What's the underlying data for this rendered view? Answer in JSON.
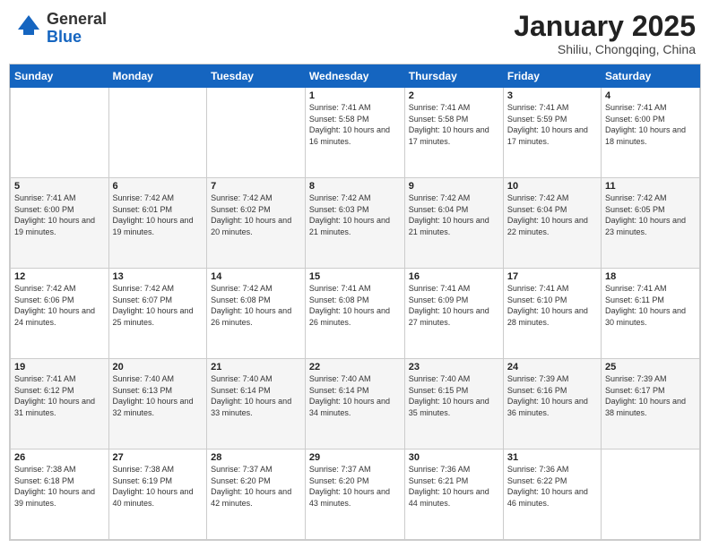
{
  "header": {
    "logo_general": "General",
    "logo_blue": "Blue",
    "month_title": "January 2025",
    "location": "Shiliu, Chongqing, China"
  },
  "days_of_week": [
    "Sunday",
    "Monday",
    "Tuesday",
    "Wednesday",
    "Thursday",
    "Friday",
    "Saturday"
  ],
  "weeks": [
    [
      {
        "day": "",
        "sunrise": "",
        "sunset": "",
        "daylight": ""
      },
      {
        "day": "",
        "sunrise": "",
        "sunset": "",
        "daylight": ""
      },
      {
        "day": "",
        "sunrise": "",
        "sunset": "",
        "daylight": ""
      },
      {
        "day": "1",
        "sunrise": "Sunrise: 7:41 AM",
        "sunset": "Sunset: 5:58 PM",
        "daylight": "Daylight: 10 hours and 16 minutes."
      },
      {
        "day": "2",
        "sunrise": "Sunrise: 7:41 AM",
        "sunset": "Sunset: 5:58 PM",
        "daylight": "Daylight: 10 hours and 17 minutes."
      },
      {
        "day": "3",
        "sunrise": "Sunrise: 7:41 AM",
        "sunset": "Sunset: 5:59 PM",
        "daylight": "Daylight: 10 hours and 17 minutes."
      },
      {
        "day": "4",
        "sunrise": "Sunrise: 7:41 AM",
        "sunset": "Sunset: 6:00 PM",
        "daylight": "Daylight: 10 hours and 18 minutes."
      }
    ],
    [
      {
        "day": "5",
        "sunrise": "Sunrise: 7:41 AM",
        "sunset": "Sunset: 6:00 PM",
        "daylight": "Daylight: 10 hours and 19 minutes."
      },
      {
        "day": "6",
        "sunrise": "Sunrise: 7:42 AM",
        "sunset": "Sunset: 6:01 PM",
        "daylight": "Daylight: 10 hours and 19 minutes."
      },
      {
        "day": "7",
        "sunrise": "Sunrise: 7:42 AM",
        "sunset": "Sunset: 6:02 PM",
        "daylight": "Daylight: 10 hours and 20 minutes."
      },
      {
        "day": "8",
        "sunrise": "Sunrise: 7:42 AM",
        "sunset": "Sunset: 6:03 PM",
        "daylight": "Daylight: 10 hours and 21 minutes."
      },
      {
        "day": "9",
        "sunrise": "Sunrise: 7:42 AM",
        "sunset": "Sunset: 6:04 PM",
        "daylight": "Daylight: 10 hours and 21 minutes."
      },
      {
        "day": "10",
        "sunrise": "Sunrise: 7:42 AM",
        "sunset": "Sunset: 6:04 PM",
        "daylight": "Daylight: 10 hours and 22 minutes."
      },
      {
        "day": "11",
        "sunrise": "Sunrise: 7:42 AM",
        "sunset": "Sunset: 6:05 PM",
        "daylight": "Daylight: 10 hours and 23 minutes."
      }
    ],
    [
      {
        "day": "12",
        "sunrise": "Sunrise: 7:42 AM",
        "sunset": "Sunset: 6:06 PM",
        "daylight": "Daylight: 10 hours and 24 minutes."
      },
      {
        "day": "13",
        "sunrise": "Sunrise: 7:42 AM",
        "sunset": "Sunset: 6:07 PM",
        "daylight": "Daylight: 10 hours and 25 minutes."
      },
      {
        "day": "14",
        "sunrise": "Sunrise: 7:42 AM",
        "sunset": "Sunset: 6:08 PM",
        "daylight": "Daylight: 10 hours and 26 minutes."
      },
      {
        "day": "15",
        "sunrise": "Sunrise: 7:41 AM",
        "sunset": "Sunset: 6:08 PM",
        "daylight": "Daylight: 10 hours and 26 minutes."
      },
      {
        "day": "16",
        "sunrise": "Sunrise: 7:41 AM",
        "sunset": "Sunset: 6:09 PM",
        "daylight": "Daylight: 10 hours and 27 minutes."
      },
      {
        "day": "17",
        "sunrise": "Sunrise: 7:41 AM",
        "sunset": "Sunset: 6:10 PM",
        "daylight": "Daylight: 10 hours and 28 minutes."
      },
      {
        "day": "18",
        "sunrise": "Sunrise: 7:41 AM",
        "sunset": "Sunset: 6:11 PM",
        "daylight": "Daylight: 10 hours and 30 minutes."
      }
    ],
    [
      {
        "day": "19",
        "sunrise": "Sunrise: 7:41 AM",
        "sunset": "Sunset: 6:12 PM",
        "daylight": "Daylight: 10 hours and 31 minutes."
      },
      {
        "day": "20",
        "sunrise": "Sunrise: 7:40 AM",
        "sunset": "Sunset: 6:13 PM",
        "daylight": "Daylight: 10 hours and 32 minutes."
      },
      {
        "day": "21",
        "sunrise": "Sunrise: 7:40 AM",
        "sunset": "Sunset: 6:14 PM",
        "daylight": "Daylight: 10 hours and 33 minutes."
      },
      {
        "day": "22",
        "sunrise": "Sunrise: 7:40 AM",
        "sunset": "Sunset: 6:14 PM",
        "daylight": "Daylight: 10 hours and 34 minutes."
      },
      {
        "day": "23",
        "sunrise": "Sunrise: 7:40 AM",
        "sunset": "Sunset: 6:15 PM",
        "daylight": "Daylight: 10 hours and 35 minutes."
      },
      {
        "day": "24",
        "sunrise": "Sunrise: 7:39 AM",
        "sunset": "Sunset: 6:16 PM",
        "daylight": "Daylight: 10 hours and 36 minutes."
      },
      {
        "day": "25",
        "sunrise": "Sunrise: 7:39 AM",
        "sunset": "Sunset: 6:17 PM",
        "daylight": "Daylight: 10 hours and 38 minutes."
      }
    ],
    [
      {
        "day": "26",
        "sunrise": "Sunrise: 7:38 AM",
        "sunset": "Sunset: 6:18 PM",
        "daylight": "Daylight: 10 hours and 39 minutes."
      },
      {
        "day": "27",
        "sunrise": "Sunrise: 7:38 AM",
        "sunset": "Sunset: 6:19 PM",
        "daylight": "Daylight: 10 hours and 40 minutes."
      },
      {
        "day": "28",
        "sunrise": "Sunrise: 7:37 AM",
        "sunset": "Sunset: 6:20 PM",
        "daylight": "Daylight: 10 hours and 42 minutes."
      },
      {
        "day": "29",
        "sunrise": "Sunrise: 7:37 AM",
        "sunset": "Sunset: 6:20 PM",
        "daylight": "Daylight: 10 hours and 43 minutes."
      },
      {
        "day": "30",
        "sunrise": "Sunrise: 7:36 AM",
        "sunset": "Sunset: 6:21 PM",
        "daylight": "Daylight: 10 hours and 44 minutes."
      },
      {
        "day": "31",
        "sunrise": "Sunrise: 7:36 AM",
        "sunset": "Sunset: 6:22 PM",
        "daylight": "Daylight: 10 hours and 46 minutes."
      },
      {
        "day": "",
        "sunrise": "",
        "sunset": "",
        "daylight": ""
      }
    ]
  ]
}
